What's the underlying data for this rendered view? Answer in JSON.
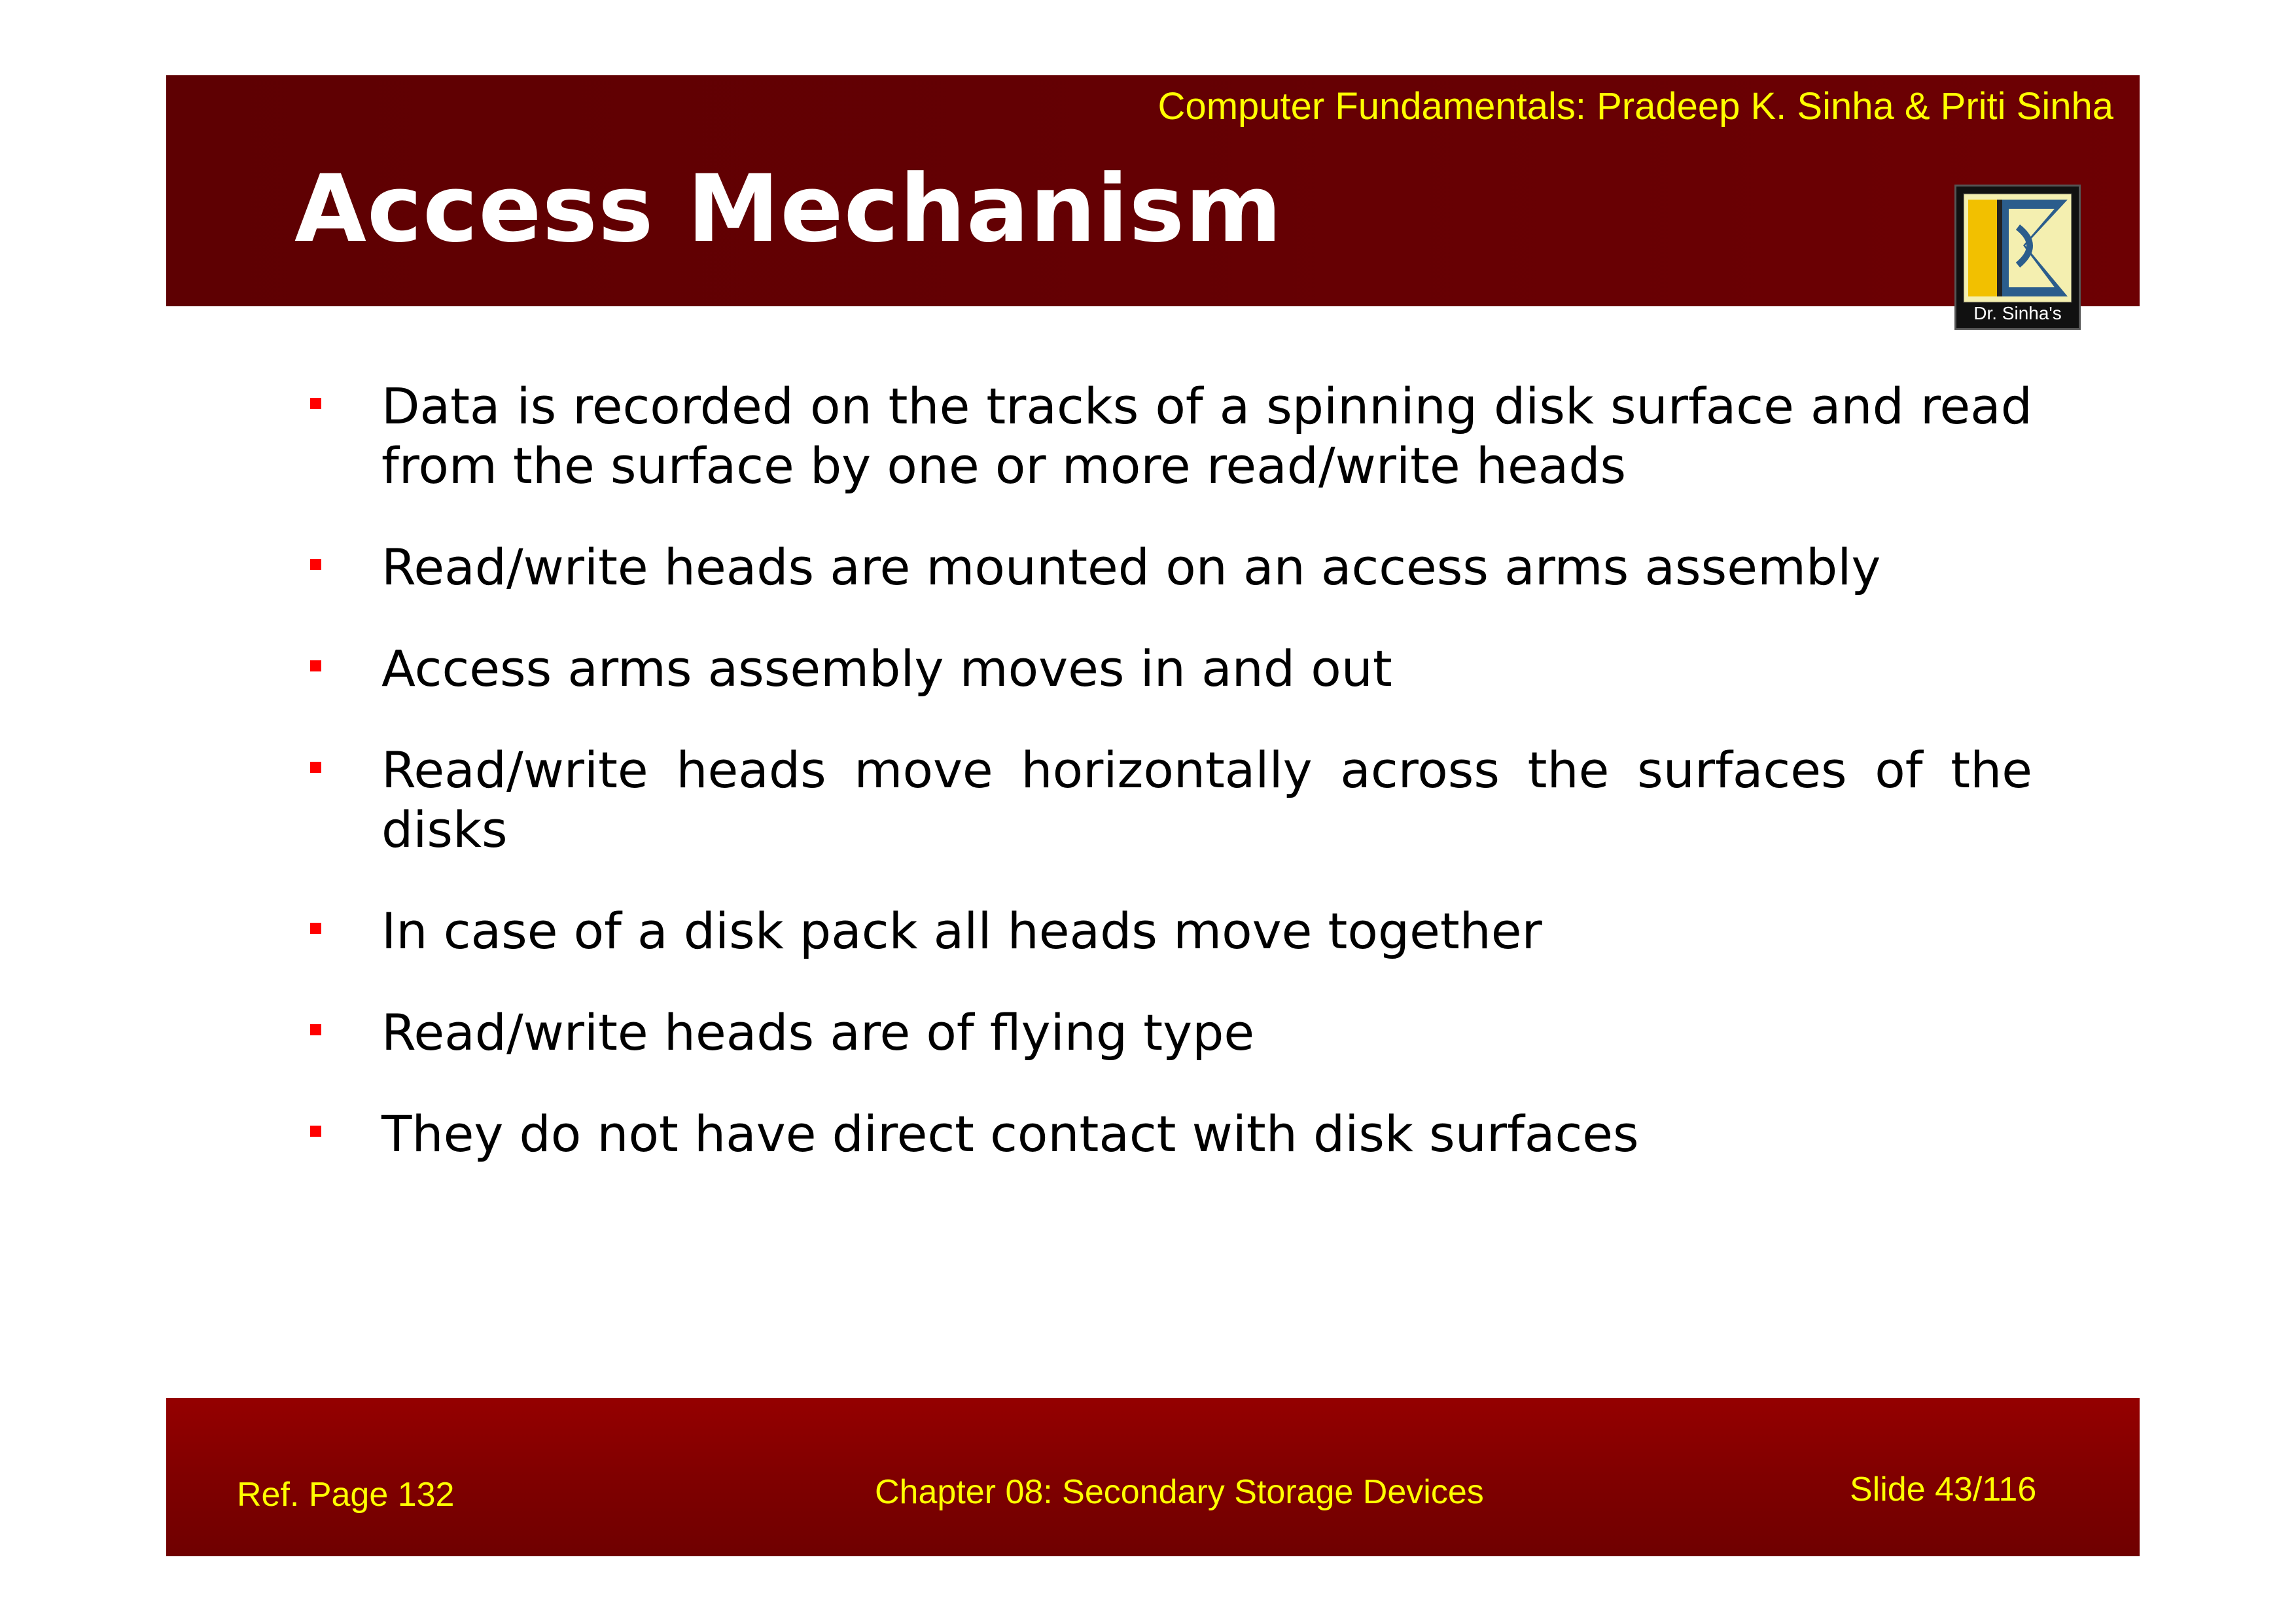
{
  "header": {
    "book_credit": "Computer Fundamentals: Pradeep K. Sinha & Priti Sinha",
    "title": "Access Mechanism",
    "logo_caption": "Dr. Sinha's"
  },
  "bullets": [
    "Data is recorded on the tracks of a spinning disk surface and read from the surface by one or more read/write heads",
    "Read/write heads are mounted on an access arms assembly",
    "Access arms assembly moves in and out",
    "Read/write heads move horizontally across the surfaces of the disks",
    "In case of a disk pack all heads move together",
    "Read/write heads are of flying type",
    "They do not have direct contact with disk surfaces"
  ],
  "footer": {
    "ref_page": "Ref. Page  132",
    "chapter": "Chapter 08: Secondary Storage Devices",
    "slide": "Slide 43/116"
  },
  "colors": {
    "header_band": "#640003",
    "footer_band": "#800000",
    "accent_text": "#ffff00",
    "bullet_marker": "#ff0000"
  }
}
